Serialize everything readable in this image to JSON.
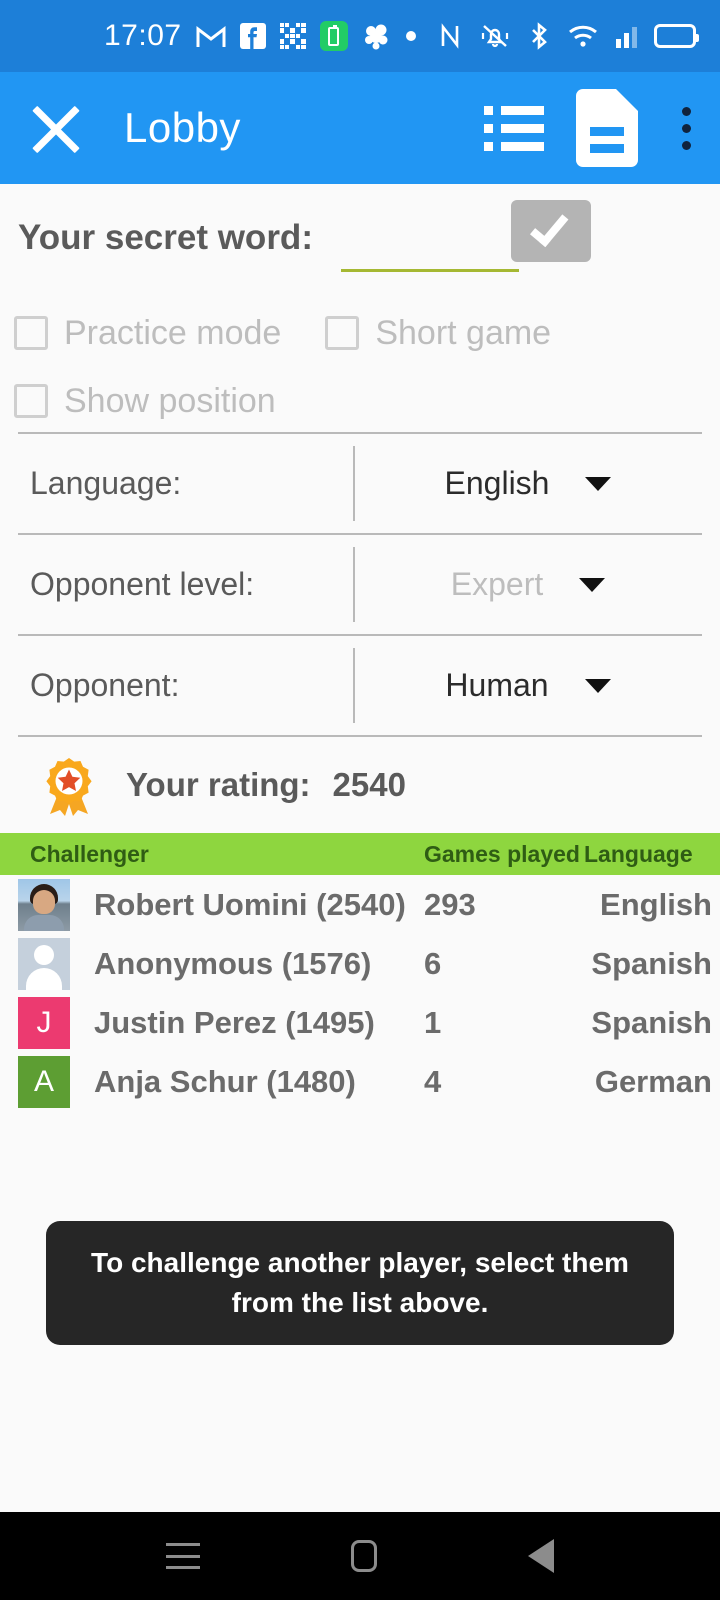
{
  "statusbar": {
    "time": "17:07",
    "left_icons": [
      "gmail-icon",
      "facebook-icon",
      "qr-code-icon",
      "battery-charging-icon",
      "brain-icon",
      "dot-icon"
    ],
    "right_icons": [
      "nfc-icon",
      "vibrate-icon",
      "bluetooth-icon",
      "wifi-icon",
      "signal-icon",
      "battery-icon"
    ],
    "background": "#1d7fd8"
  },
  "appbar": {
    "title": "Lobby",
    "background": "#2196f3",
    "close_icon": "close-icon",
    "list_icon": "list-icon",
    "document_icon": "document-icon",
    "overflow_icon": "more-vert-icon"
  },
  "secret": {
    "label": "Your secret word:",
    "value": "",
    "placeholder": "",
    "underline_color": "#a5b832",
    "ok_label": "",
    "ok_icon": "check-icon"
  },
  "checkboxes": [
    {
      "label": "Practice mode",
      "checked": false,
      "enabled": false
    },
    {
      "label": "Short game",
      "checked": false,
      "enabled": false
    },
    {
      "label": "Show position",
      "checked": false,
      "enabled": false
    }
  ],
  "settings": [
    {
      "label": "Language:",
      "value": "English",
      "dim": false
    },
    {
      "label": "Opponent level:",
      "value": "Expert",
      "dim": true
    },
    {
      "label": "Opponent:",
      "value": "Human",
      "dim": false
    }
  ],
  "rating": {
    "icon": "award-badge-icon",
    "label": "Your rating:",
    "value": "2540"
  },
  "table": {
    "header_background": "#8ed63f",
    "columns": [
      "Challenger",
      "Games played",
      "Language"
    ],
    "rows": [
      {
        "avatar_type": "photo",
        "avatar_initial": "",
        "avatar_color": "#9fc6e8",
        "name": "Robert Uomini (2540)",
        "games": "293",
        "language": "English"
      },
      {
        "avatar_type": "silhouette",
        "avatar_initial": "",
        "avatar_color": "#c5d0dc",
        "name": "Anonymous (1576)",
        "games": "6",
        "language": "Spanish"
      },
      {
        "avatar_type": "initial",
        "avatar_initial": "J",
        "avatar_color": "#ec3a70",
        "name": "Justin Perez (1495)",
        "games": "1",
        "language": "Spanish"
      },
      {
        "avatar_type": "initial",
        "avatar_initial": "A",
        "avatar_color": "#5d9e33",
        "name": "Anja Schur (1480)",
        "games": "4",
        "language": "German"
      }
    ]
  },
  "toast": {
    "message": "To challenge another player, select them from the list above."
  },
  "navbar": {
    "recents_icon": "recents-icon",
    "home_icon": "home-icon",
    "back_icon": "back-icon"
  }
}
